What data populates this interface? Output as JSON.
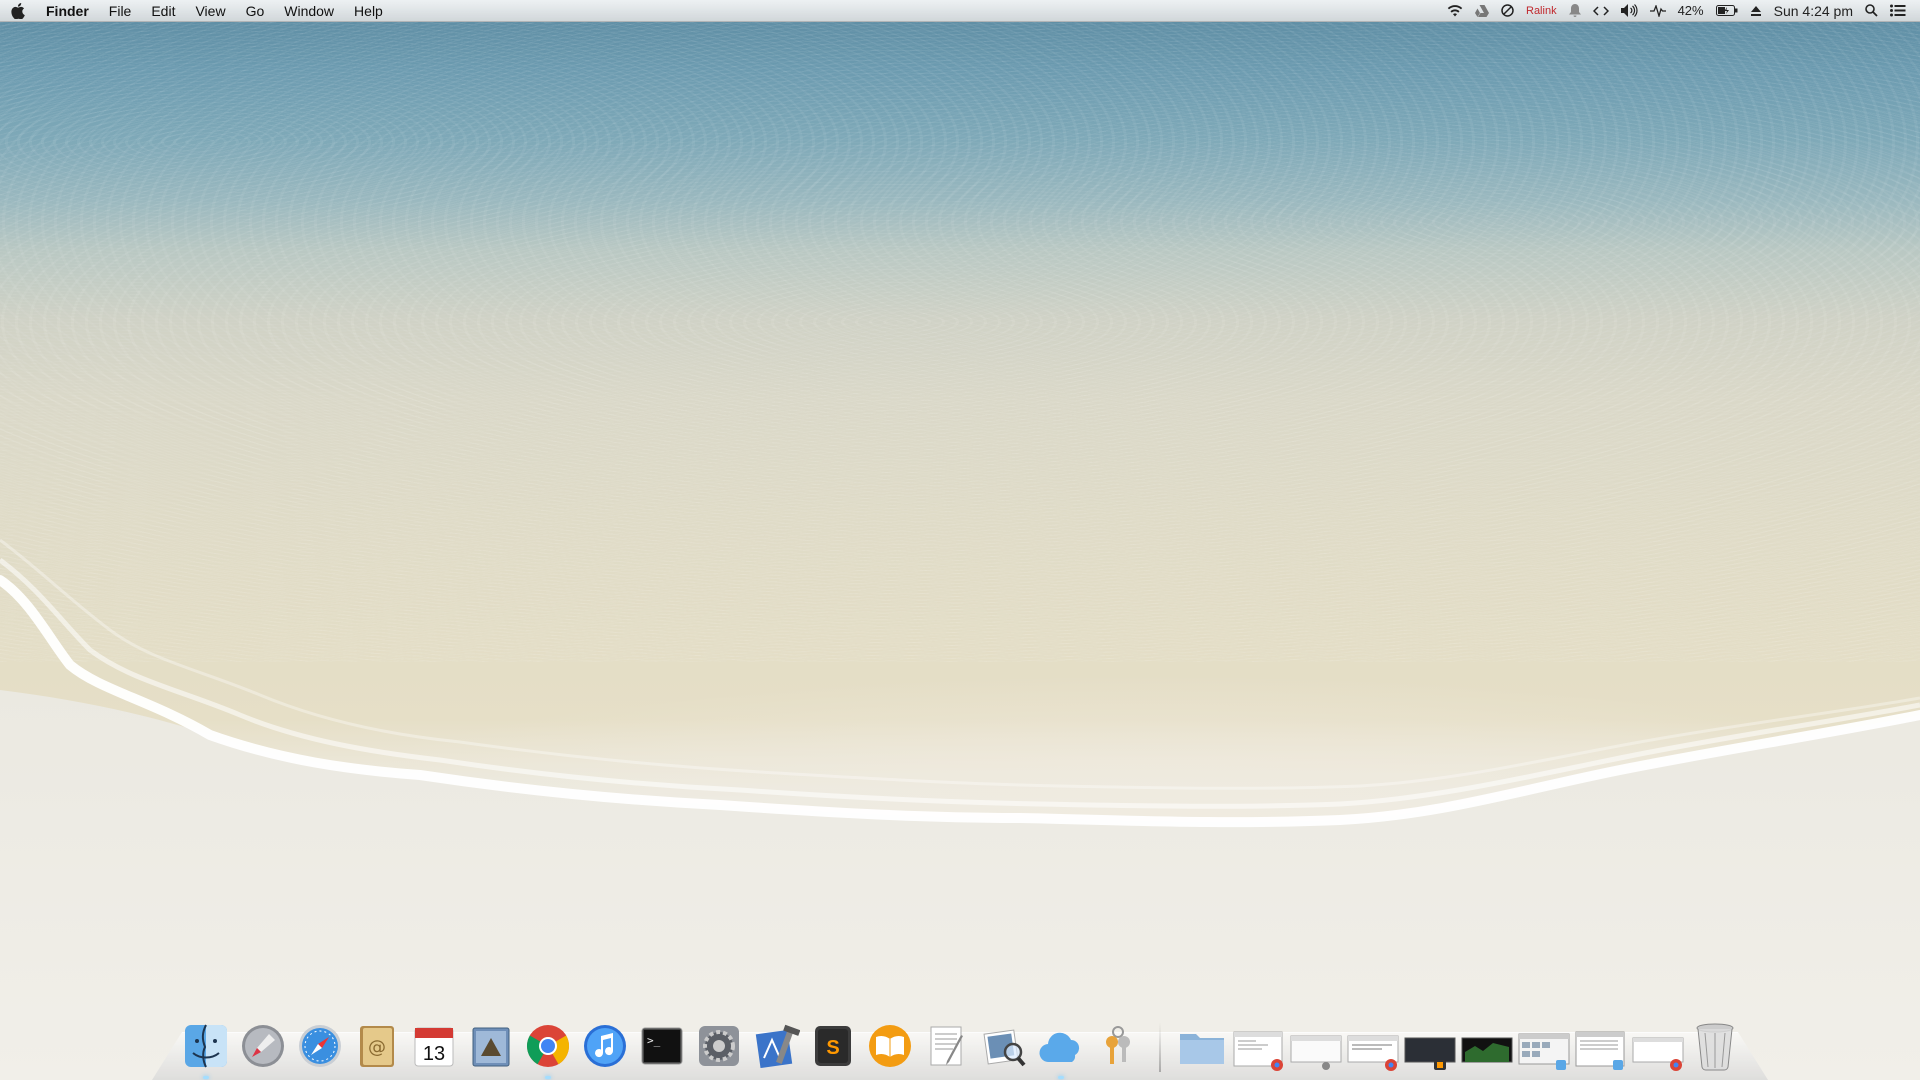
{
  "menubar": {
    "app_name": "Finder",
    "menus": [
      "File",
      "Edit",
      "View",
      "Go",
      "Window",
      "Help"
    ],
    "status": {
      "ralink": "Ralink",
      "battery": "42%",
      "clock": "Sun 4:24 pm"
    }
  },
  "dock": {
    "apps": [
      {
        "name": "Finder",
        "icon": "finder-icon",
        "running": true
      },
      {
        "name": "Launchpad",
        "icon": "launchpad-icon",
        "running": false
      },
      {
        "name": "Safari",
        "icon": "safari-icon",
        "running": false
      },
      {
        "name": "Contacts",
        "icon": "contacts-icon",
        "running": false
      },
      {
        "name": "Calendar",
        "icon": "calendar-icon",
        "running": false,
        "badge": "13"
      },
      {
        "name": "Mail",
        "icon": "mail-icon",
        "running": false
      },
      {
        "name": "Google Chrome",
        "icon": "chrome-icon",
        "running": true
      },
      {
        "name": "iTunes",
        "icon": "itunes-icon",
        "running": false
      },
      {
        "name": "Terminal",
        "icon": "terminal-icon",
        "running": false,
        "label": ">_"
      },
      {
        "name": "System Preferences",
        "icon": "system-preferences-icon",
        "running": false
      },
      {
        "name": "Xcode",
        "icon": "xcode-icon",
        "running": false
      },
      {
        "name": "Sublime Text",
        "icon": "sublime-text-icon",
        "running": false,
        "label": "S"
      },
      {
        "name": "iBooks",
        "icon": "ibooks-icon",
        "running": false
      },
      {
        "name": "TextEdit",
        "icon": "textedit-icon",
        "running": false
      },
      {
        "name": "Preview",
        "icon": "preview-icon",
        "running": false
      },
      {
        "name": "CloudApp",
        "icon": "cloud-app-icon",
        "running": true
      },
      {
        "name": "Keychain Access",
        "icon": "keychain-icon",
        "running": false
      }
    ],
    "stacks": [
      {
        "name": "Documents folder",
        "icon": "folder-icon"
      },
      {
        "name": "Minimized Chrome window 1",
        "icon": "window-thumbnail-icon",
        "badge_app": "chrome"
      },
      {
        "name": "Minimized window 2",
        "icon": "window-thumbnail-icon",
        "badge_app": "preview"
      },
      {
        "name": "Minimized Chrome window 3",
        "icon": "window-thumbnail-icon",
        "badge_app": "chrome"
      },
      {
        "name": "Minimized Sublime window",
        "icon": "window-thumbnail-icon",
        "badge_app": "sublime"
      },
      {
        "name": "Minimized terminal window",
        "icon": "window-thumbnail-icon",
        "badge_app": "terminal"
      },
      {
        "name": "Minimized Finder window 1",
        "icon": "window-thumbnail-icon",
        "badge_app": "finder"
      },
      {
        "name": "Minimized Finder window 2",
        "icon": "window-thumbnail-icon",
        "badge_app": "finder"
      },
      {
        "name": "Minimized Chrome window 4",
        "icon": "window-thumbnail-icon",
        "badge_app": "chrome"
      },
      {
        "name": "Trash",
        "icon": "trash-icon"
      }
    ]
  }
}
